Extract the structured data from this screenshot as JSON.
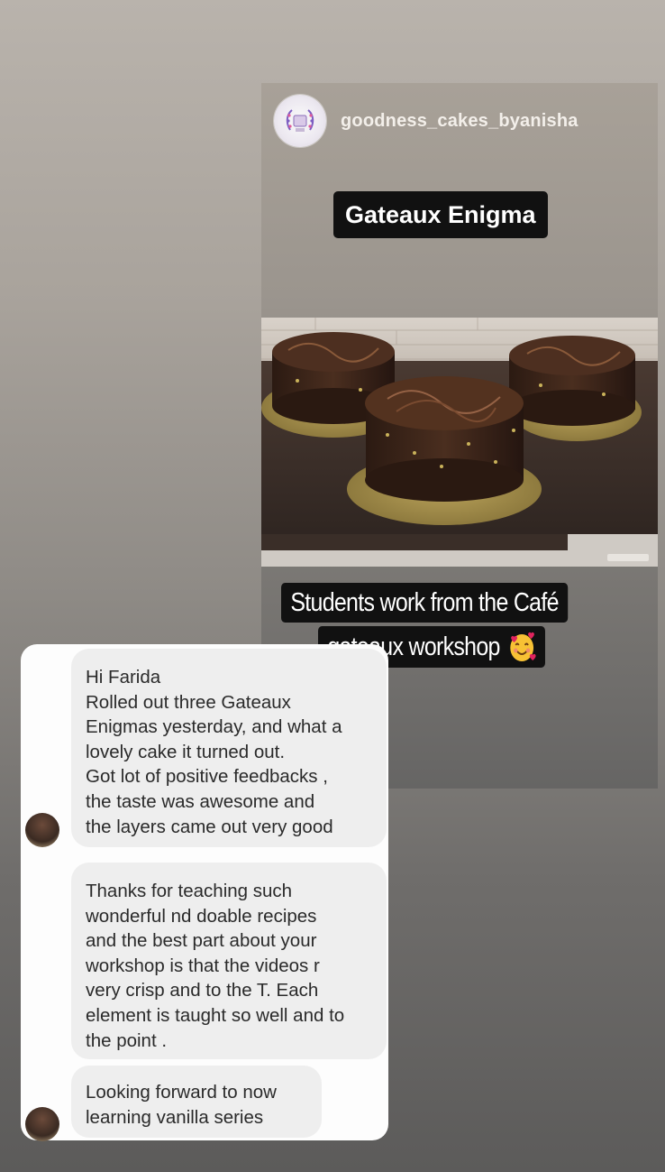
{
  "story": {
    "username": "goodness_cakes_byanisha",
    "title_tag": "Gateaux Enigma",
    "caption_line1": "Students work from the Café",
    "caption_line2": "gateaux workshop",
    "caption_emoji": "smiling-face-with-hearts"
  },
  "chat": {
    "messages": [
      {
        "text": "Hi Farida\nRolled out three Gateaux\nEnigmas yesterday, and what a\nlovely cake it turned out.\nGot lot of positive feedbacks ,\nthe taste was awesome and\nthe layers came out very good"
      },
      {
        "text": "Thanks for teaching such\nwonderful nd doable recipes\nand the best part about your\nworkshop is that the videos r\nvery crisp and to the T. Each\nelement is taught so well and to\nthe point ."
      },
      {
        "text": "Looking forward to now\nlearning vanilla series"
      }
    ]
  },
  "colors": {
    "tag_background": "#111111",
    "bubble_background": "#eeeeee",
    "chat_panel": "#fdfdfd"
  }
}
